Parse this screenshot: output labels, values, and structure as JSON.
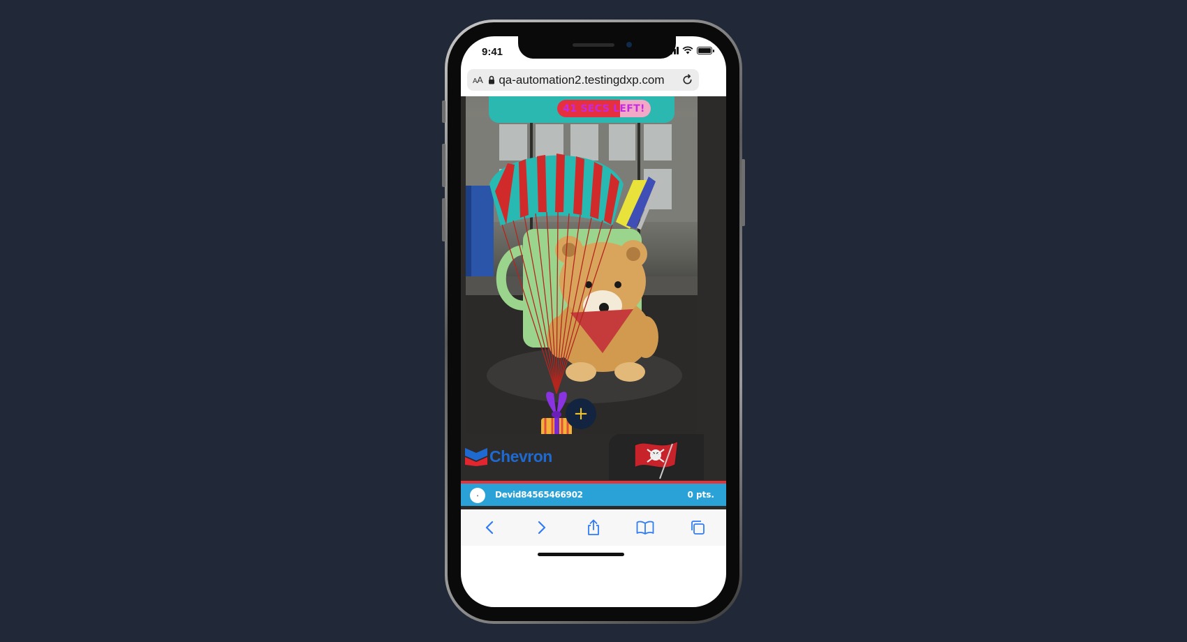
{
  "status_bar": {
    "time": "9:41"
  },
  "browser": {
    "text_size_label_small": "A",
    "text_size_label_large": "A",
    "url": "qa-automation2.testingdxp.com"
  },
  "game": {
    "timer_text": "41 SECS LEFT!",
    "timer_progress": 0.67,
    "sponsor_left": "Chevron",
    "add_button_label": "+",
    "user": {
      "avatar_label": "•",
      "name": "Devid84565466902",
      "points": "0 pts."
    }
  },
  "colors": {
    "background": "#212837",
    "timer_banner": "#2bb8b0",
    "timer_fill": "#e7303f",
    "timer_rest": "#f2a8c7",
    "timer_text": "#c42be0",
    "user_bar": "#2aa2d7",
    "user_bar_accent": "#e83038",
    "add_button": "#12243f",
    "add_button_plus": "#f0c52a",
    "chevron_blue": "#1f6ad0",
    "ios_blue": "#2f7cf6"
  },
  "icons": {
    "lock": "lock-icon",
    "reload": "reload-icon",
    "back": "chevron-left-icon",
    "forward": "chevron-right-icon",
    "share": "share-icon",
    "bookmarks": "book-icon",
    "tabs": "tabs-icon",
    "parachute_gift": "parachute-gift-icon"
  }
}
